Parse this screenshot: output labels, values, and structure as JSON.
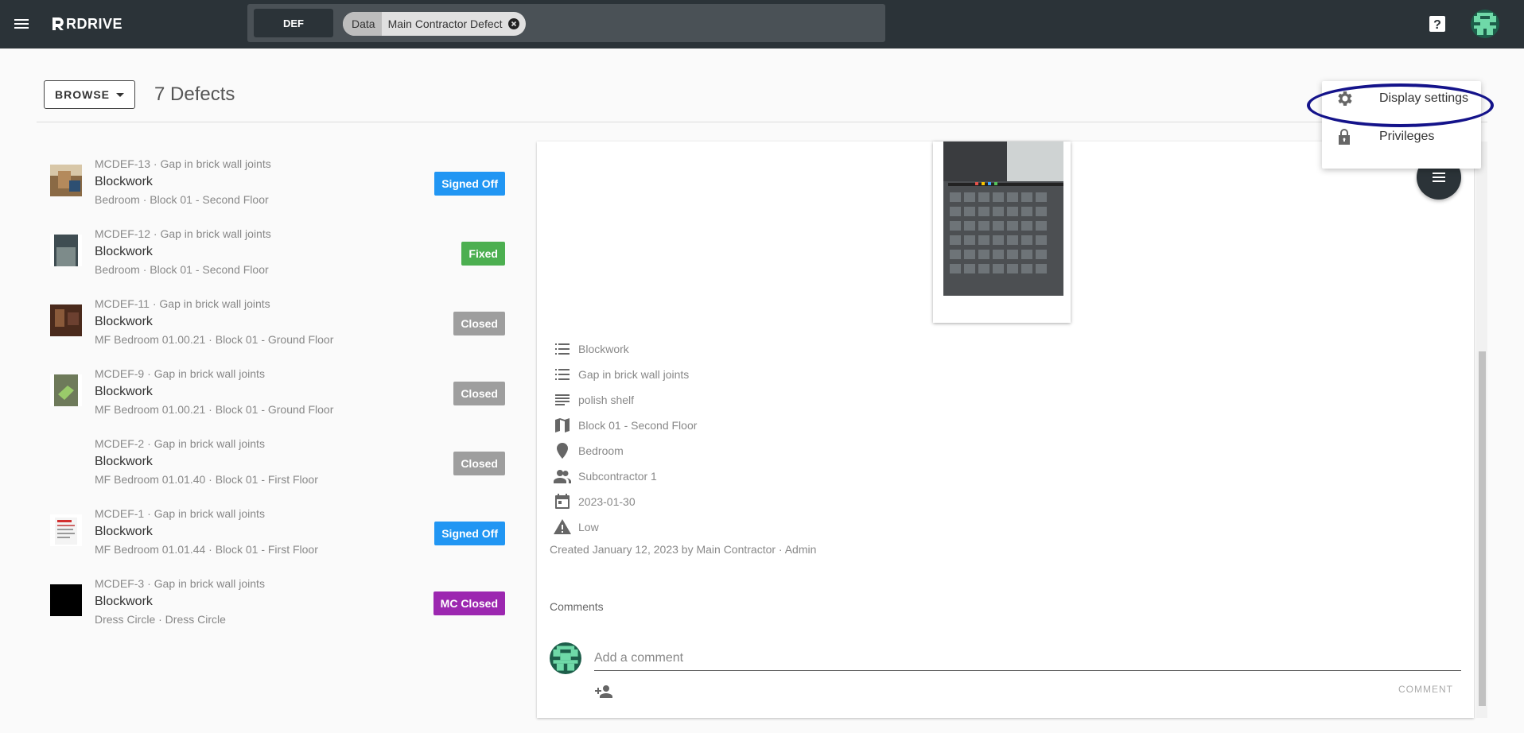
{
  "topbar": {
    "logo_text": "RDRIVE",
    "project_code": "DEF",
    "filter_chip": {
      "key": "Data",
      "value": "Main Contractor Defect"
    }
  },
  "toolbar": {
    "browse_label": "BROWSE",
    "count_title": "7 Defects"
  },
  "defects": [
    {
      "ref": "MCDEF-13 · Gap in brick wall joints",
      "title": "Blockwork",
      "location": "Bedroom · Block 01 - Second Floor",
      "status": "Signed Off",
      "status_color": "#2196f3"
    },
    {
      "ref": "MCDEF-12 · Gap in brick wall joints",
      "title": "Blockwork",
      "location": "Bedroom · Block 01 - Second Floor",
      "status": "Fixed",
      "status_color": "#4caf50"
    },
    {
      "ref": "MCDEF-11 · Gap in brick wall joints",
      "title": "Blockwork",
      "location": "MF Bedroom 01.00.21 · Block 01 - Ground Floor",
      "status": "Closed",
      "status_color": "#9e9e9e"
    },
    {
      "ref": "MCDEF-9 · Gap in brick wall joints",
      "title": "Blockwork",
      "location": "MF Bedroom 01.00.21 · Block 01 - Ground Floor",
      "status": "Closed",
      "status_color": "#9e9e9e"
    },
    {
      "ref": "MCDEF-2 · Gap in brick wall joints",
      "title": "Blockwork",
      "location": "MF Bedroom 01.01.40 · Block 01 - First Floor",
      "status": "Closed",
      "status_color": "#9e9e9e"
    },
    {
      "ref": "MCDEF-1 · Gap in brick wall joints",
      "title": "Blockwork",
      "location": "MF Bedroom 01.01.44 · Block 01 - First Floor",
      "status": "Signed Off",
      "status_color": "#2196f3"
    },
    {
      "ref": "MCDEF-3 · Gap in brick wall joints",
      "title": "Blockwork",
      "location": "Dress Circle · Dress Circle",
      "status": "MC Closed",
      "status_color": "#9c27b0"
    }
  ],
  "detail": {
    "properties": {
      "category": "Blockwork",
      "type": "Gap in brick wall joints",
      "description": "polish shelf",
      "floor": "Block 01 - Second Floor",
      "room": "Bedroom",
      "assignee": "Subcontractor 1",
      "due_date": "2023-01-30",
      "priority": "Low"
    },
    "created": "Created January 12, 2023 by Main Contractor · Admin",
    "comments_label": "Comments",
    "comment_placeholder": "Add a comment",
    "comment_button": "COMMENT"
  },
  "menu": {
    "display_settings": "Display settings",
    "privileges": "Privileges"
  },
  "colors": {
    "topbar": "#2b3338",
    "highlight_ring": "#14138a"
  }
}
